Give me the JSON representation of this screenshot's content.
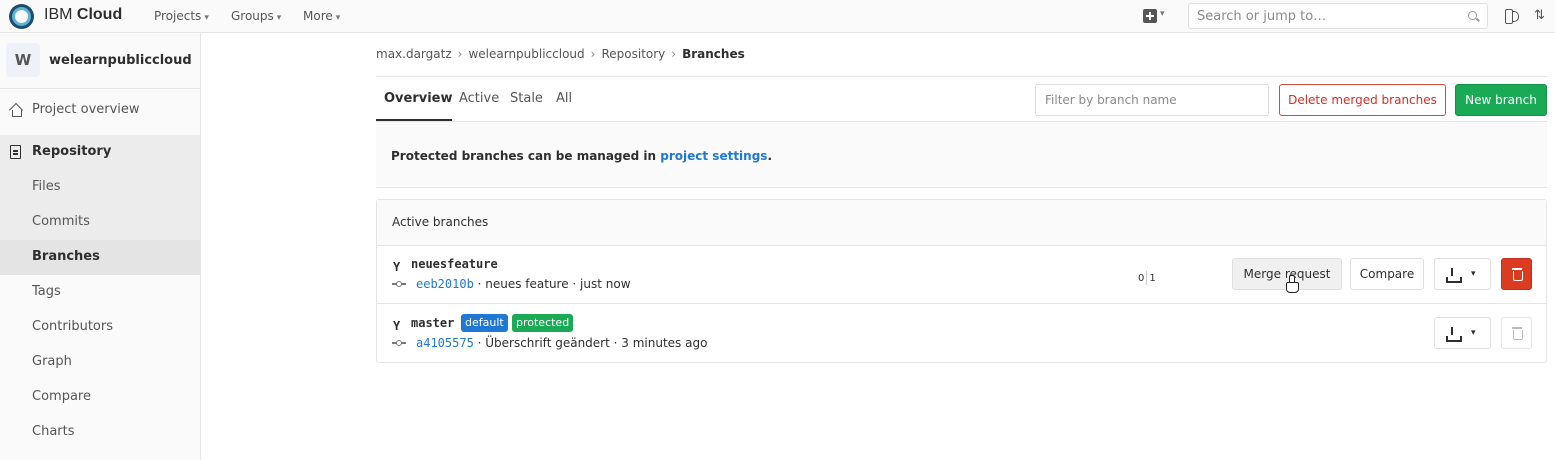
{
  "topbar": {
    "brand_prefix": "IBM",
    "brand_main": "Cloud",
    "nav": [
      "Projects",
      "Groups",
      "More"
    ],
    "search_placeholder": "Search or jump to…"
  },
  "sidebar": {
    "avatar_letter": "W",
    "project_name": "welearnpubliccloud",
    "overview": "Project overview",
    "repository": "Repository",
    "items": [
      "Files",
      "Commits",
      "Branches",
      "Tags",
      "Contributors",
      "Graph",
      "Compare",
      "Charts"
    ],
    "active_item": "Branches"
  },
  "breadcrumb": {
    "items": [
      "max.dargatz",
      "welearnpubliccloud",
      "Repository"
    ],
    "current": "Branches",
    "separator": "›"
  },
  "tabs": [
    "Overview",
    "Active",
    "Stale",
    "All"
  ],
  "active_tab": "Overview",
  "filter_placeholder": "Filter by branch name",
  "buttons": {
    "delete_merged": "Delete merged branches",
    "new_branch": "New branch"
  },
  "notice": {
    "text": "Protected branches can be managed in ",
    "link": "project settings",
    "suffix": "."
  },
  "panel_title": "Active branches",
  "branches": [
    {
      "name": "neuesfeature",
      "sha": "eeb2010b",
      "message": " · neues feature · just now",
      "behind": "0",
      "ahead": "1",
      "merge_request_label": "Merge request",
      "compare_label": "Compare"
    },
    {
      "name": "master",
      "badges": [
        "default",
        "protected"
      ],
      "sha": "a4105575",
      "message": " · Überschrift geändert · 3 minutes ago"
    }
  ],
  "colors": {
    "accent_blue": "#1f78d1",
    "success_green": "#1aaa55",
    "danger_red": "#db3b21"
  }
}
